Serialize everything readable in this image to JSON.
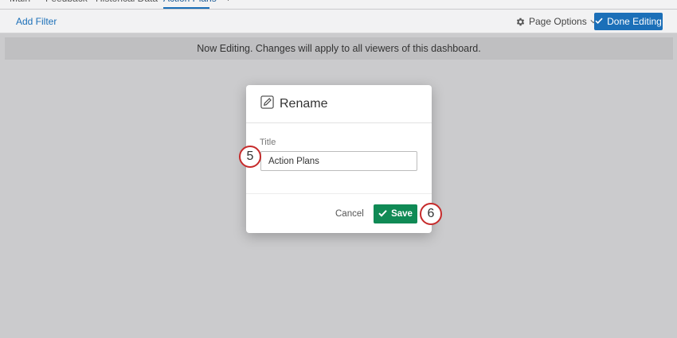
{
  "tabs": [
    {
      "label": "Main",
      "active": false
    },
    {
      "label": "Feedback",
      "active": false
    },
    {
      "label": "Historical Data",
      "active": false
    },
    {
      "label": "Action Plans",
      "active": true
    },
    {
      "label": "+",
      "active": false
    }
  ],
  "toolbar": {
    "add_filter": "Add Filter",
    "page_options": "Page Options",
    "done_editing": "Done Editing"
  },
  "banner": {
    "text": "Now Editing. Changes will apply to all viewers of this dashboard."
  },
  "modal": {
    "title": "Rename",
    "field_label": "Title",
    "title_value": "Action Plans",
    "cancel_label": "Cancel",
    "save_label": "Save"
  },
  "callouts": {
    "step_title": "5",
    "step_save": "6"
  },
  "colors": {
    "primary_blue": "#1b6fb8",
    "save_green": "#108a55",
    "callout_red": "#c62b2b",
    "overlay_gray": "#cbcbcd"
  }
}
